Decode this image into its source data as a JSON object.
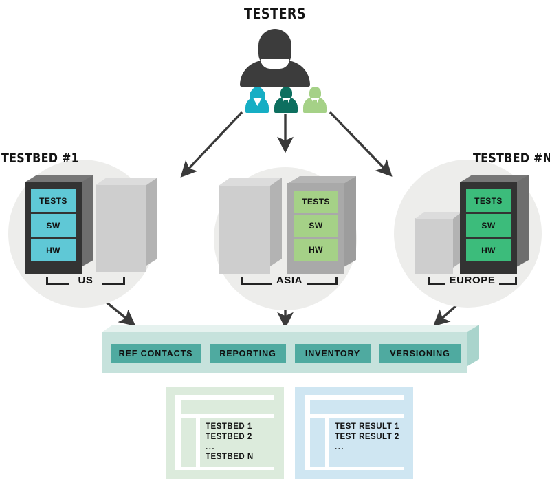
{
  "diagram": {
    "title": "TESTERS",
    "actors": {
      "primary_icon": "person-icon",
      "small_people": [
        {
          "name": "tester-person-1",
          "color": "#16AEC4"
        },
        {
          "name": "tester-person-2",
          "color": "#0D6F5F"
        },
        {
          "name": "tester-person-3",
          "color": "#A5D187"
        }
      ]
    },
    "testbeds": [
      {
        "title": "TESTBED #1",
        "region": "US",
        "accent": "#5FC8D6",
        "frame": "#333333",
        "slots": [
          "TESTS",
          "SW",
          "HW"
        ],
        "rack_side": "left"
      },
      {
        "title": "",
        "region": "ASIA",
        "accent": "#A5D187",
        "frame": "#A9A9A9",
        "slots": [
          "TESTS",
          "SW",
          "HW"
        ],
        "rack_side": "right"
      },
      {
        "title": "TESTBED #N",
        "region": "EUROPE",
        "accent": "#3CBC7B",
        "frame": "#333333",
        "slots": [
          "TESTS",
          "SW",
          "HW"
        ],
        "rack_side": "right"
      }
    ],
    "platform": {
      "fill": "#C6E2DC",
      "button_fill": "#4FAAA0",
      "services": [
        "REF CONTACTS",
        "REPORTING",
        "INVENTORY",
        "VERSIONING"
      ]
    },
    "panels": [
      {
        "name": "testbeds-panel",
        "fill": "#DCEBDC",
        "lines": [
          "TESTBED 1",
          "TESTBED 2",
          "...",
          "TESTBED N"
        ]
      },
      {
        "name": "test-results-panel",
        "fill": "#CFE6F2",
        "lines": [
          "TEST RESULT 1",
          "TEST RESULT 2",
          "...",
          ""
        ]
      }
    ],
    "arrow_color": "#3a3a3a"
  }
}
